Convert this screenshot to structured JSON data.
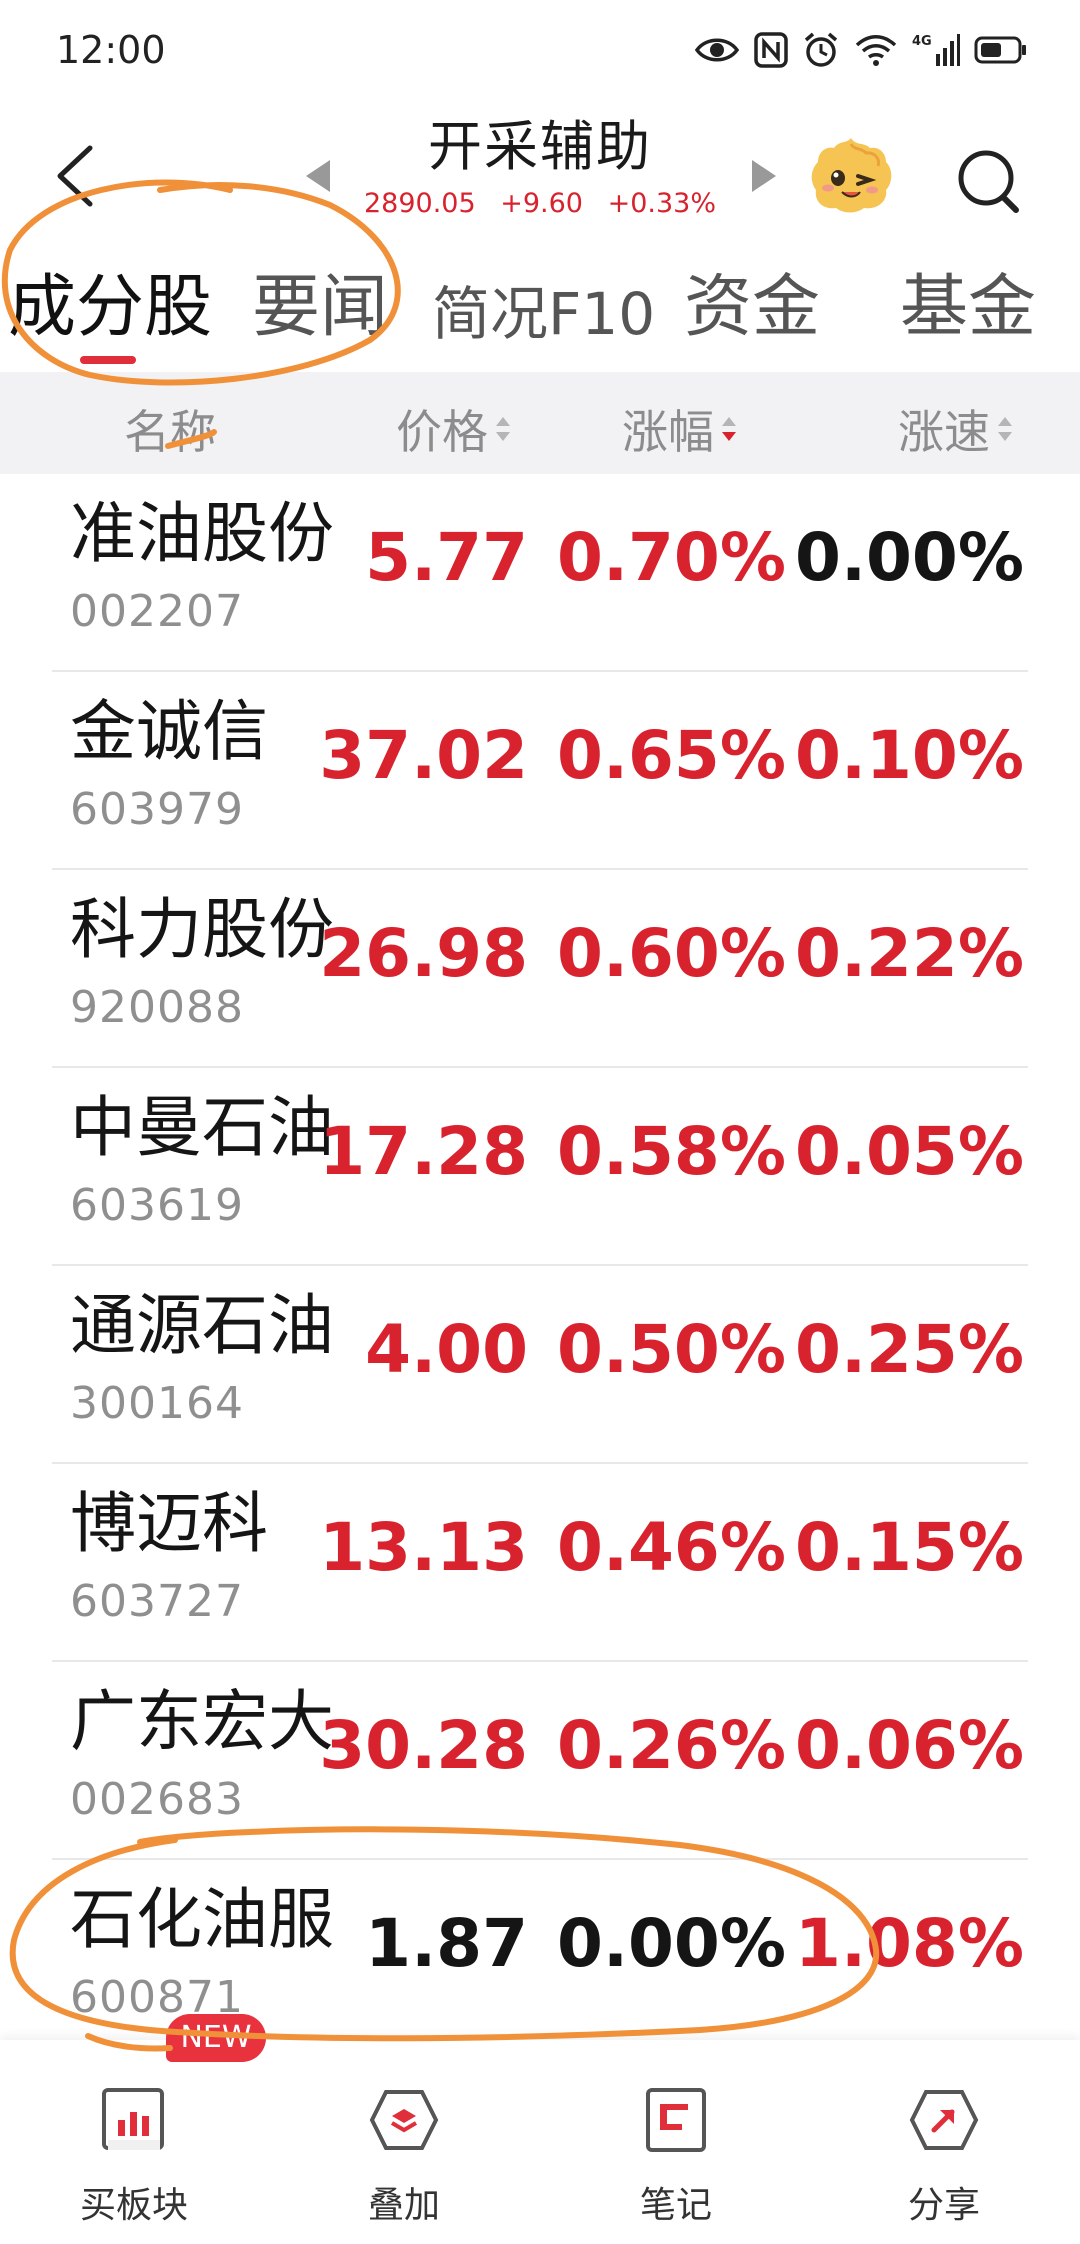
{
  "status_bar": {
    "time": "12:00",
    "icons": [
      "eye-icon",
      "nfc-icon",
      "alarm-icon",
      "wifi-icon",
      "signal-4g-icon",
      "battery-icon"
    ]
  },
  "header": {
    "title": "开采辅助",
    "index_value": "2890.05",
    "change": "+9.60",
    "change_pct": "+0.33%"
  },
  "tabs": [
    {
      "label": "成分股",
      "active": true
    },
    {
      "label": "要闻",
      "active": false
    },
    {
      "label": "简况F10",
      "active": false
    },
    {
      "label": "资金",
      "active": false
    },
    {
      "label": "基金",
      "active": false
    }
  ],
  "columns": {
    "name": "名称",
    "price": "价格",
    "change_pct": "涨幅",
    "speed": "涨速"
  },
  "stocks": [
    {
      "name": "准油股份",
      "code": "002207",
      "price": "5.77",
      "change_pct": "0.70%",
      "speed": "0.00%"
    },
    {
      "name": "金诚信",
      "code": "603979",
      "price": "37.02",
      "change_pct": "0.65%",
      "speed": "0.10%"
    },
    {
      "name": "科力股份",
      "code": "920088",
      "price": "26.98",
      "change_pct": "0.60%",
      "speed": "0.22%"
    },
    {
      "name": "中曼石油",
      "code": "603619",
      "price": "17.28",
      "change_pct": "0.58%",
      "speed": "0.05%"
    },
    {
      "name": "通源石油",
      "code": "300164",
      "price": "4.00",
      "change_pct": "0.50%",
      "speed": "0.25%"
    },
    {
      "name": "博迈科",
      "code": "603727",
      "price": "13.13",
      "change_pct": "0.46%",
      "speed": "0.15%"
    },
    {
      "name": "广东宏大",
      "code": "002683",
      "price": "30.28",
      "change_pct": "0.26%",
      "speed": "0.06%"
    },
    {
      "name": "石化油服",
      "code": "600871",
      "price": "1.87",
      "change_pct": "0.00%",
      "speed": "1.08%"
    }
  ],
  "bottom_bar": {
    "items": [
      {
        "label": "买板块",
        "icon": "bar-chart-icon"
      },
      {
        "label": "叠加",
        "icon": "layers-icon"
      },
      {
        "label": "笔记",
        "icon": "note-icon"
      },
      {
        "label": "分享",
        "icon": "share-icon"
      }
    ],
    "badge": "NEW"
  },
  "colors": {
    "up_red": "#d8232f",
    "neutral": "#151515",
    "annotation_orange": "#f0913a",
    "header_bg": "#f2f2f4"
  }
}
